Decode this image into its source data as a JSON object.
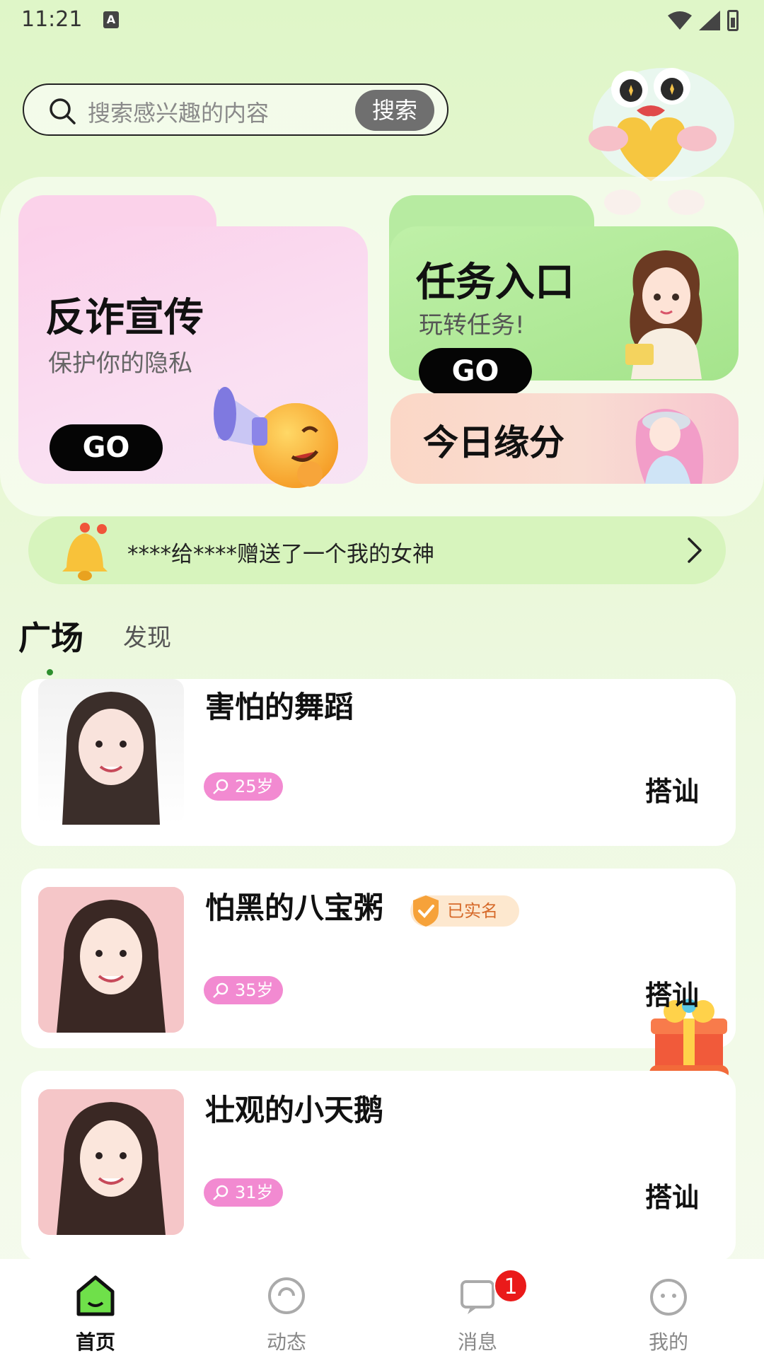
{
  "status": {
    "time": "11:21",
    "indicator": "A"
  },
  "search": {
    "placeholder": "搜索感兴趣的内容",
    "button": "搜索"
  },
  "promo": {
    "fraud": {
      "title": "反诈宣传",
      "subtitle": "保护你的隐私",
      "go": "GO"
    },
    "task": {
      "title": "任务入口",
      "subtitle": "玩转任务!",
      "go": "GO"
    },
    "fate": {
      "title": "今日缘分"
    }
  },
  "notice": {
    "text": "****给****赠送了一个我的女神"
  },
  "tabs": {
    "square": "广场",
    "discover": "发现"
  },
  "users": [
    {
      "name": "害怕的舞蹈",
      "age": "25岁",
      "action": "搭讪"
    },
    {
      "name": "怕黑的八宝粥",
      "verified": "已实名",
      "age": "35岁",
      "action": "搭讪"
    },
    {
      "name": "壮观的小天鹅",
      "age": "31岁",
      "action": "搭讪"
    }
  ],
  "nav": {
    "home": "首页",
    "feed": "动态",
    "messages": "消息",
    "messages_badge": "1",
    "mine": "我的"
  },
  "colors": {
    "accent_green": "#2e8f2e",
    "badge_pink": "#f28ad1",
    "notify_red": "#ea1a1a"
  }
}
